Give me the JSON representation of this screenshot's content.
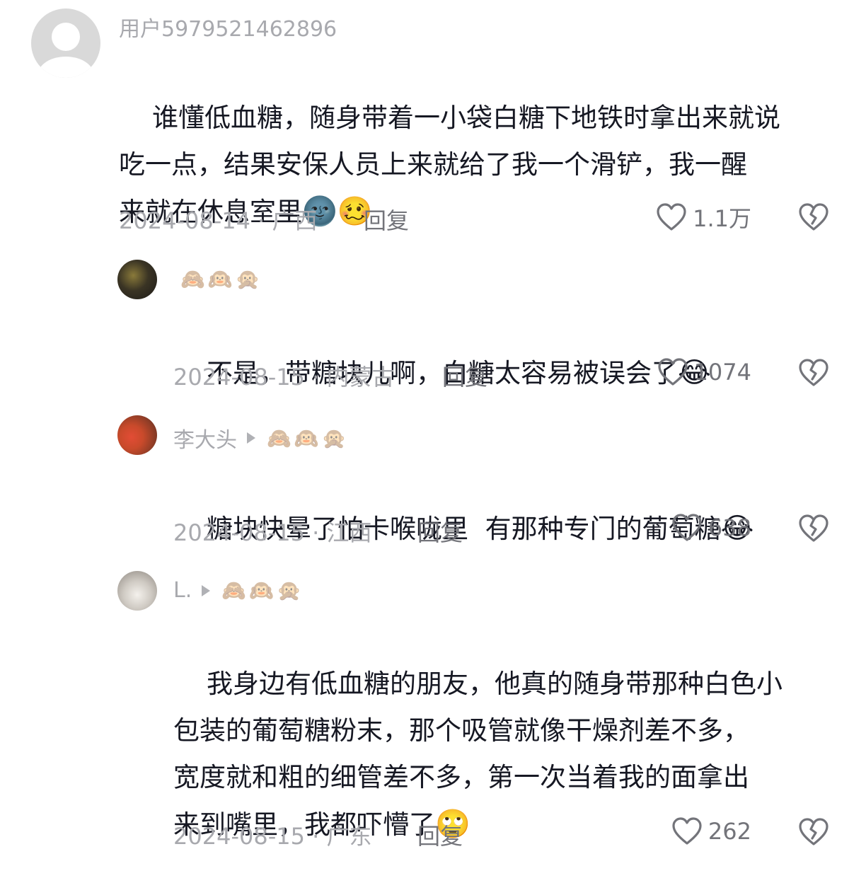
{
  "comments": [
    {
      "username": "用户5979521462896",
      "text": "谁懂低血糖，随身带着一小袋白糖下地铁时拿出来就说\n吃一点，结果安保人员上来就给了我一个滑铲，我一醒\n来就在休息室里",
      "emoji": "🌚🥴",
      "date": "2024-08-14",
      "region": "广西",
      "reply_label": "回复",
      "likes": "1.1万"
    },
    {
      "username": "",
      "username_emoji": "🙈🙉🙊",
      "text": "不是，带糖块儿啊，白糖太容易被误会了",
      "emoji": "😂",
      "date": "2024-08-15",
      "region": "内蒙古",
      "reply_label": "回复",
      "likes": "1074"
    },
    {
      "username": "李大头",
      "username_emoji": "🙈🙉🙊",
      "text": "糖块快晕了怕卡喉咙里  有那种专门的葡萄糖",
      "emoji": "😂",
      "date": "2024-08-15",
      "region": "江西",
      "reply_label": "回复",
      "likes": "638"
    },
    {
      "username": "L.",
      "username_emoji": "🙈🙉🙊",
      "text": "我身边有低血糖的朋友，他真的随身带那种白色小\n包装的葡萄糖粉末，那个吸管就像干燥剂差不多，\n宽度就和粗的细管差不多，第一次当着我的面拿出\n来到嘴里，我都吓懵了",
      "emoji": "🙄",
      "date": "2024-08-15",
      "region": "广东",
      "reply_label": "回复",
      "likes": "262"
    }
  ],
  "meta_separator": " · ",
  "icons": {
    "like": "heart-outline-icon",
    "dislike": "broken-heart-icon",
    "forward": "play-triangle-icon"
  }
}
